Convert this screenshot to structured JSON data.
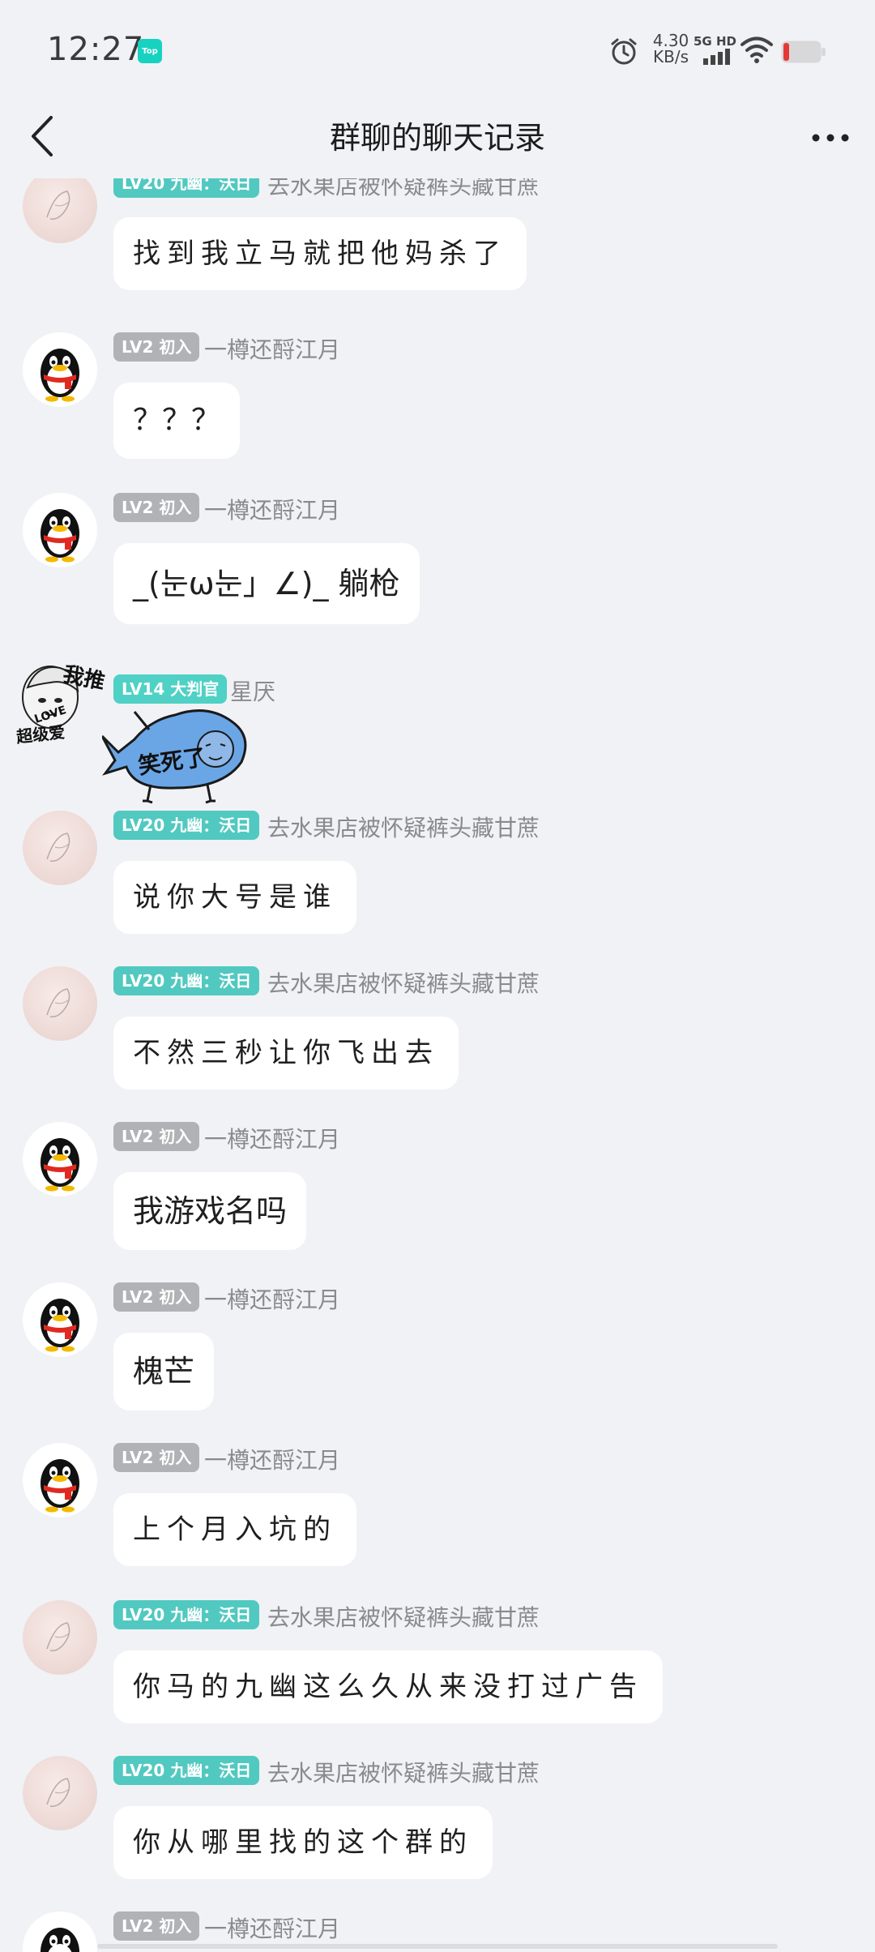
{
  "status_bar": {
    "time": "12:27",
    "badge": "Top",
    "net_speed_value": "4.30",
    "net_speed_unit": "KB/s",
    "net_type": "5G HD"
  },
  "nav": {
    "title": "群聊的聊天记录"
  },
  "messages": [
    {
      "avatar": "sketch-avatar",
      "level": "LV20 九幽：沃日",
      "nickname": "去水果店被怀疑裤头藏甘蔗",
      "text": "找到我立马就把他妈杀了"
    },
    {
      "avatar": "penguin-avatar",
      "level": "LV2 初入",
      "nickname": "一樽还酹江月",
      "text": "？？？"
    },
    {
      "avatar": "penguin-avatar",
      "level": "LV2 初入",
      "nickname": "一樽还酹江月",
      "text": "_(눈ω눈」∠)_ 躺枪"
    },
    {
      "avatar": "sticker-avatar",
      "level": "LV14 大判官",
      "nickname": "星厌",
      "sticker_text": "笑死了"
    },
    {
      "avatar": "sketch-avatar",
      "level": "LV20 九幽：沃日",
      "nickname": "去水果店被怀疑裤头藏甘蔗",
      "text": "说你大号是谁"
    },
    {
      "avatar": "sketch-avatar",
      "level": "LV20 九幽：沃日",
      "nickname": "去水果店被怀疑裤头藏甘蔗",
      "text": "不然三秒让你飞出去"
    },
    {
      "avatar": "penguin-avatar",
      "level": "LV2 初入",
      "nickname": "一樽还酹江月",
      "text": "我游戏名吗"
    },
    {
      "avatar": "penguin-avatar",
      "level": "LV2 初入",
      "nickname": "一樽还酹江月",
      "text": "槐芒"
    },
    {
      "avatar": "penguin-avatar",
      "level": "LV2 初入",
      "nickname": "一樽还酹江月",
      "text": "上个月入坑的"
    },
    {
      "avatar": "sketch-avatar",
      "level": "LV20 九幽：沃日",
      "nickname": "去水果店被怀疑裤头藏甘蔗",
      "text": "你马的九幽这么久从来没打过广告"
    },
    {
      "avatar": "sketch-avatar",
      "level": "LV20 九幽：沃日",
      "nickname": "去水果店被怀疑裤头藏甘蔗",
      "text": "你从哪里找的这个群的"
    },
    {
      "avatar": "penguin-avatar",
      "level": "LV2 初入",
      "nickname": "一樽还酹江月"
    }
  ],
  "sticker_avatar_text": [
    "我推",
    "LOVE",
    "超级爱"
  ],
  "colors": {
    "background": "#f1f2f6",
    "bubble": "#ffffff",
    "level_teal": "#52c9c0",
    "level_gray": "#b1b2b6",
    "nickname": "#8a8a8e",
    "battery_low": "#e53935"
  }
}
